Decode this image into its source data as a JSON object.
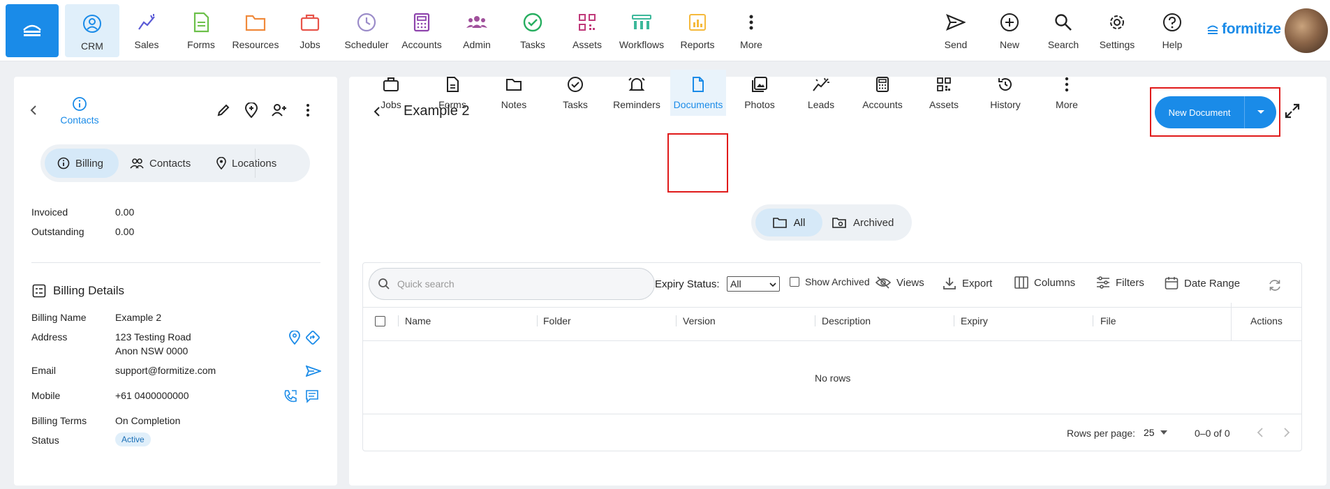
{
  "nav": {
    "items": [
      {
        "label": "CRM",
        "icon": "crm-icon",
        "color": "#1a8be8"
      },
      {
        "label": "Sales",
        "icon": "sales-icon",
        "color": "#5b5bd6"
      },
      {
        "label": "Forms",
        "icon": "forms-icon",
        "color": "#6cc04a"
      },
      {
        "label": "Resources",
        "icon": "folder-icon",
        "color": "#f08a3c"
      },
      {
        "label": "Jobs",
        "icon": "briefcase-icon",
        "color": "#e8544a"
      },
      {
        "label": "Scheduler",
        "icon": "clock-icon",
        "color": "#9b8cc9"
      },
      {
        "label": "Accounts",
        "icon": "calculator-icon",
        "color": "#8e44ad"
      },
      {
        "label": "Admin",
        "icon": "users-icon",
        "color": "#a0509b"
      },
      {
        "label": "Tasks",
        "icon": "check-circle-icon",
        "color": "#27ae60"
      },
      {
        "label": "Assets",
        "icon": "qr-icon",
        "color": "#c0397a"
      },
      {
        "label": "Workflows",
        "icon": "workflow-icon",
        "color": "#3cb89a"
      },
      {
        "label": "Reports",
        "icon": "report-icon",
        "color": "#f5b93b"
      },
      {
        "label": "More",
        "icon": "more-vertical-icon",
        "color": "#222"
      }
    ],
    "right_items": [
      {
        "label": "Send",
        "icon": "send-icon"
      },
      {
        "label": "New",
        "icon": "plus-circle-icon"
      },
      {
        "label": "Search",
        "icon": "search-icon"
      },
      {
        "label": "Settings",
        "icon": "gear-icon"
      },
      {
        "label": "Help",
        "icon": "help-icon"
      }
    ],
    "logo_text": "formitize",
    "accent": "#1a8be8"
  },
  "left": {
    "contacts_label": "Contacts",
    "segments": [
      {
        "label": "Billing",
        "icon": "info-icon"
      },
      {
        "label": "Contacts",
        "icon": "contacts-icon"
      },
      {
        "label": "Locations",
        "icon": "location-icon"
      }
    ],
    "invoiced_label": "Invoiced",
    "invoiced_value": "0.00",
    "outstanding_label": "Outstanding",
    "outstanding_value": "0.00",
    "billing_details_title": "Billing Details",
    "fields": {
      "billing_name_label": "Billing Name",
      "billing_name": "Example 2",
      "address_label": "Address",
      "address_line1": "123 Testing Road",
      "address_line2": "Anon NSW 0000",
      "email_label": "Email",
      "email": "support@formitize.com",
      "mobile_label": "Mobile",
      "mobile": "+61 0400000000",
      "terms_label": "Billing Terms",
      "terms": "On Completion",
      "status_label": "Status",
      "status": "Active"
    }
  },
  "main": {
    "title": "Example 2",
    "new_document_label": "New Document",
    "tabs": [
      {
        "label": "Jobs",
        "icon": "briefcase-icon"
      },
      {
        "label": "Forms",
        "icon": "forms-icon"
      },
      {
        "label": "Notes",
        "icon": "notes-icon"
      },
      {
        "label": "Tasks",
        "icon": "check-circle-icon"
      },
      {
        "label": "Reminders",
        "icon": "bell-icon"
      },
      {
        "label": "Documents",
        "icon": "document-icon"
      },
      {
        "label": "Photos",
        "icon": "photos-icon"
      },
      {
        "label": "Leads",
        "icon": "leads-icon"
      },
      {
        "label": "Accounts",
        "icon": "calculator-icon"
      },
      {
        "label": "Assets",
        "icon": "qr-icon"
      },
      {
        "label": "History",
        "icon": "history-icon"
      },
      {
        "label": "More",
        "icon": "more-vertical-icon"
      }
    ],
    "filter_all": "All",
    "filter_archived": "Archived",
    "search_placeholder": "Quick search",
    "expiry_status_label": "Expiry Status:",
    "expiry_status_value": "All",
    "show_archived_label": "Show Archived",
    "views_label": "Views",
    "export_label": "Export",
    "columns_label": "Columns",
    "filters_label": "Filters",
    "date_range_label": "Date Range",
    "columns": [
      "Name",
      "Folder",
      "Version",
      "Description",
      "Expiry",
      "File",
      "Actions"
    ],
    "empty_text": "No rows",
    "rows_per_page_label": "Rows per page:",
    "rows_per_page_value": "25",
    "pagination_text": "0–0 of 0"
  }
}
